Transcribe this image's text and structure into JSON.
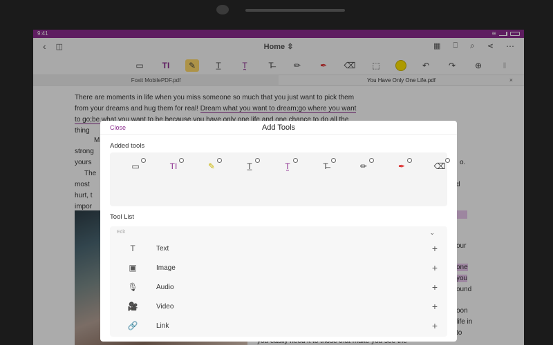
{
  "status": {
    "time": "9:41"
  },
  "header": {
    "title": "Home",
    "title_chevron": "⇳"
  },
  "tabs": [
    {
      "label": "Foxit MobilePDF.pdf"
    },
    {
      "label": "You Have Only One Life.pdf",
      "close": "×"
    }
  ],
  "document": {
    "line1": "There are moments in life when you miss someone so much that you just want to pick them",
    "line2a": "from your dreams and hug them for real! ",
    "line2b": "Dream what you want to dream;go where you want",
    "line3a": "to go;be what you want to be,",
    "line3b": "because you have only one life and one chance to do all the",
    "line4": "thing",
    "frag_m": "M",
    "frag_strong": "strong",
    "frag_yours": "yours",
    "frag_the": "The",
    "frag_most": "most",
    "frag_hurt": "hurt, t",
    "frag_impo": "impor",
    "right_o": "o.",
    "right_d": "d",
    "right_our": "our",
    "right_one": "one",
    "right_you": "you",
    "right_ound": "ound",
    "right_oon": "oon",
    "right_life_in": "life in",
    "right_to": "to",
    "bottom_line": "you easily need it to those that make you see the"
  },
  "modal": {
    "close_label": "Close",
    "title": "Add Tools",
    "added_label": "Added tools",
    "list_label": "Tool List",
    "category": "Edit",
    "category_chevron": "⌄",
    "added_tools": [
      {
        "icon": "note-icon",
        "glyph": "💬"
      },
      {
        "icon": "typewriter-icon",
        "glyph": "TI"
      },
      {
        "icon": "highlight-icon",
        "glyph": "✎"
      },
      {
        "icon": "underline-icon",
        "glyph": "T̲"
      },
      {
        "icon": "squiggly-icon",
        "glyph": "T̰"
      },
      {
        "icon": "strikeout-icon",
        "glyph": "T̶"
      },
      {
        "icon": "pencil-icon",
        "glyph": "✏"
      },
      {
        "icon": "pen-red-icon",
        "glyph": "✒"
      },
      {
        "icon": "eraser-icon",
        "glyph": "⌫"
      }
    ],
    "tool_list": [
      {
        "label": "Text",
        "glyph": "T",
        "add": "+"
      },
      {
        "label": "Image",
        "glyph": "▣",
        "add": "+"
      },
      {
        "label": "Audio",
        "glyph": "🎙",
        "add": "+"
      },
      {
        "label": "Video",
        "glyph": "🎥",
        "add": "+"
      },
      {
        "label": "Link",
        "glyph": "🔗",
        "add": "+"
      }
    ]
  },
  "colors": {
    "accent": "#8b2c8e",
    "highlight": "#ffe400",
    "statusbar": "#8b2c8e"
  }
}
